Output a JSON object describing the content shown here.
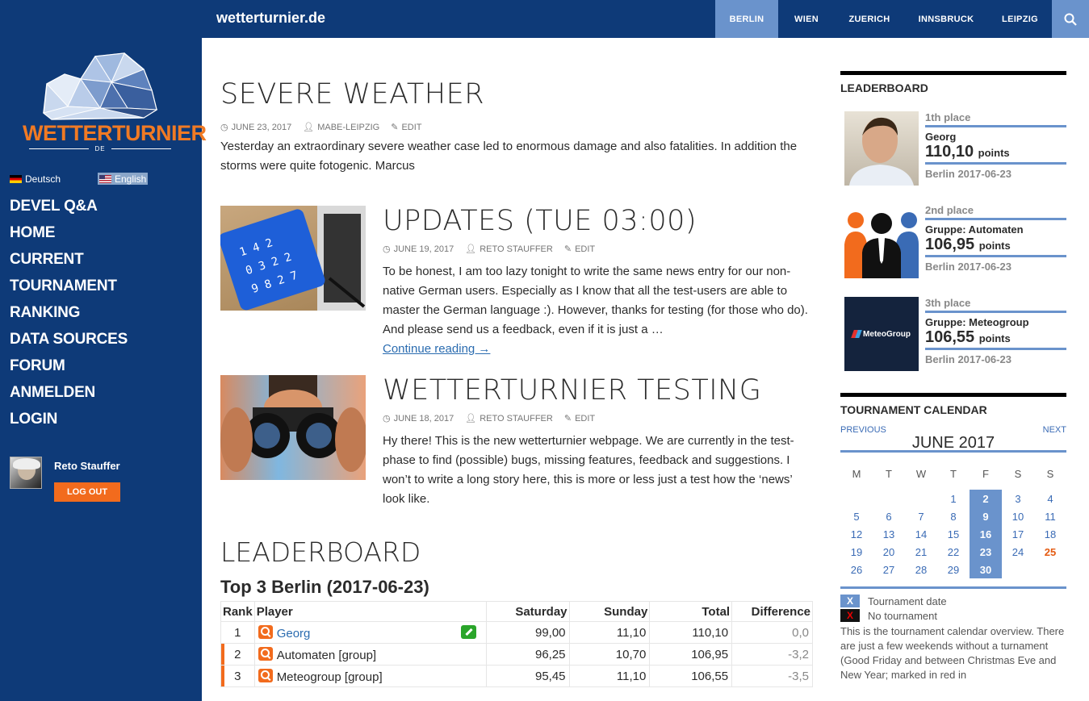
{
  "site": {
    "title": "wetterturnier.de"
  },
  "cities": [
    "BERLIN",
    "WIEN",
    "ZUERICH",
    "INNSBRUCK",
    "LEIPZIG"
  ],
  "active_city": "BERLIN",
  "logo": {
    "text": "WETTERTURNIER",
    "sub": "DE"
  },
  "languages": {
    "de": "Deutsch",
    "en": "English"
  },
  "nav": [
    "DEVEL Q&A",
    "HOME",
    "CURRENT",
    "TOURNAMENT",
    "RANKING",
    "DATA SOURCES",
    "FORUM",
    "ANMELDEN",
    "LOGIN"
  ],
  "user": {
    "name": "Reto Stauffer",
    "logout": "LOG OUT"
  },
  "posts": [
    {
      "title": "SEVERE WEATHER",
      "date": "JUNE 23, 2017",
      "author": "MABE-LEIPZIG",
      "edit": "EDIT",
      "body": "Yesterday an extraordinary severe weather case led to enormous damage and also fatalities. In addition the storms were quite fotogenic. Marcus"
    },
    {
      "title": "UPDATES (TUE 03:00)",
      "date": "JUNE 19, 2017",
      "author": "RETO STAUFFER",
      "edit": "EDIT",
      "body": "To be honest, I am too lazy tonight to write the same news entry for our non-native German users. Especially as I know that all the test-users are able to master the German language :). However, thanks for testing (for those who do). And please send us a feedback, even if it is just a …",
      "more": "Continue reading →"
    },
    {
      "title": "WETTERTURNIER TESTING",
      "date": "JUNE 18, 2017",
      "author": "RETO STAUFFER",
      "edit": "EDIT",
      "body": "Hy there! This is the new wetterturnier webpage. We are currently in the test-phase to find (possible) bugs, missing features, feedback and suggestions. I won’t to write a long story here, this is more or less just a test how the ‘news’ look like."
    }
  ],
  "leaderboard_main": {
    "title": "LEADERBOARD",
    "subtitle": "Top 3 Berlin (2017-06-23)",
    "headers": [
      "Rank",
      "Player",
      "Saturday",
      "Sunday",
      "Total",
      "Difference"
    ],
    "rows": [
      {
        "rank": "1",
        "player": "Georg",
        "sat": "99,00",
        "sun": "11,10",
        "total": "110,10",
        "diff": "0,0"
      },
      {
        "rank": "2",
        "player": "Automaten [group]",
        "sat": "96,25",
        "sun": "10,70",
        "total": "106,95",
        "diff": "-3,2"
      },
      {
        "rank": "3",
        "player": "Meteogroup [group]",
        "sat": "95,45",
        "sun": "11,10",
        "total": "106,55",
        "diff": "-3,5"
      }
    ]
  },
  "leaderboard_side": {
    "title": "LEADERBOARD",
    "points_label": "points",
    "entries": [
      {
        "place": "1th place",
        "name": "Georg",
        "points": "110,10",
        "date": "Berlin 2017-06-23"
      },
      {
        "place": "2nd place",
        "name": "Gruppe: Automaten",
        "points": "106,95",
        "date": "Berlin 2017-06-23"
      },
      {
        "place": "3th place",
        "name": "Gruppe: Meteogroup",
        "points": "106,55",
        "date": "Berlin 2017-06-23"
      }
    ],
    "meteogroup_logo": "MeteoGroup"
  },
  "calendar": {
    "title": "TOURNAMENT CALENDAR",
    "prev": "PREVIOUS",
    "next": "NEXT",
    "month": "JUNE 2017",
    "weekdays": [
      "M",
      "T",
      "W",
      "T",
      "F",
      "S",
      "S"
    ],
    "weeks": [
      [
        "",
        "",
        "",
        "1",
        "2",
        "3",
        "4"
      ],
      [
        "5",
        "6",
        "7",
        "8",
        "9",
        "10",
        "11"
      ],
      [
        "12",
        "13",
        "14",
        "15",
        "16",
        "17",
        "18"
      ],
      [
        "19",
        "20",
        "21",
        "22",
        "23",
        "24",
        "25"
      ],
      [
        "26",
        "27",
        "28",
        "29",
        "30",
        "",
        ""
      ]
    ],
    "red_day": "25",
    "legend": [
      {
        "mark": "X",
        "label": "Tournament date"
      },
      {
        "mark": "X",
        "label": "No tournament"
      }
    ],
    "text": "This is the tournament calendar overview. There are just a few weekends without a turnament (Good Friday and between Christmas Eve and New Year; marked in red in"
  },
  "colors": {
    "navy": "#0e3a78",
    "accent": "#6a93cc",
    "orange": "#f26b1d"
  }
}
